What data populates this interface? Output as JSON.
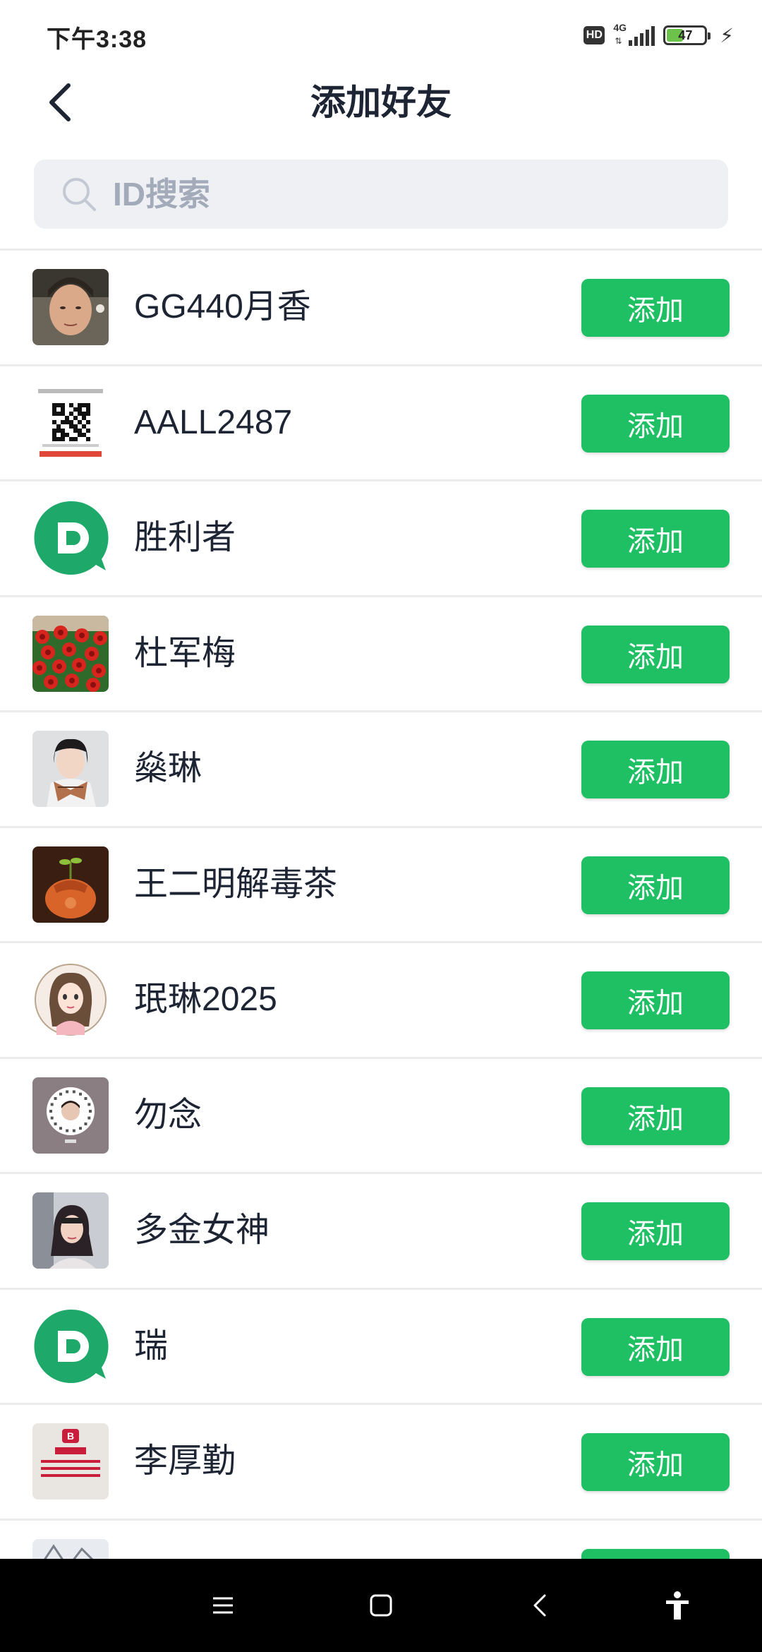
{
  "status_bar": {
    "time": "下午3:38",
    "hd": "HD",
    "network": "4G",
    "battery_level": "47",
    "battery_percent": 47
  },
  "header": {
    "title": "添加好友"
  },
  "search": {
    "placeholder": "ID搜索",
    "value": ""
  },
  "list": {
    "add_label": "添加",
    "users": [
      {
        "name": "GG440月香",
        "avatar": "elderly-woman-photo"
      },
      {
        "name": "AALL2487",
        "avatar": "qr-code-image"
      },
      {
        "name": "胜利者",
        "avatar": "default-app-logo"
      },
      {
        "name": "杜军梅",
        "avatar": "red-flowers-photo"
      },
      {
        "name": "燊琳",
        "avatar": "woman-with-scarf-photo"
      },
      {
        "name": "王二明解毒茶",
        "avatar": "tea-pouch-photo"
      },
      {
        "name": "珉琳2025",
        "avatar": "cartoon-girl-portrait"
      },
      {
        "name": "勿念",
        "avatar": "qr-code-portrait"
      },
      {
        "name": "多金女神",
        "avatar": "woman-in-car-photo"
      },
      {
        "name": "瑞",
        "avatar": "default-app-logo"
      },
      {
        "name": "李厚勤",
        "avatar": "brand-logo-card"
      },
      {
        "name": "",
        "avatar": "winter-tree-photo"
      }
    ]
  },
  "nav": {
    "icons": [
      "menu-icon",
      "home-icon",
      "back-icon",
      "accessibility-icon"
    ]
  },
  "colors": {
    "accent": "#1fbf63",
    "title": "#1d2433",
    "search_bg": "#eef0f4",
    "placeholder": "#a3abba"
  }
}
